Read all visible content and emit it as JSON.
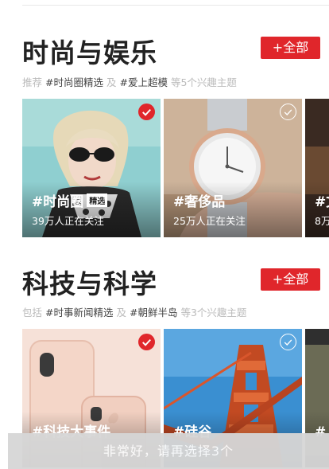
{
  "sections": [
    {
      "title": "时尚与娱乐",
      "all_button": "+全部",
      "sub_prefix": "推荐",
      "sub_topic1": "#时尚圈精选",
      "sub_and": "及",
      "sub_topic2": "#爱上超模",
      "sub_suffix": "等5个兴趣主题",
      "cards": [
        {
          "tag": "#时尚圈",
          "badge": "精选",
          "follow": "39万人正在关注",
          "checked": true
        },
        {
          "tag": "#奢侈品",
          "follow": "25万人正在关注",
          "checked": false
        },
        {
          "tag": "#文",
          "follow": "8万"
        }
      ]
    },
    {
      "title": "科技与科学",
      "all_button": "+全部",
      "sub_prefix": "包括",
      "sub_topic1": "#时事新闻精选",
      "sub_and": "及",
      "sub_topic2": "#朝鲜半岛",
      "sub_suffix": "等3个兴趣主题",
      "cards": [
        {
          "tag": "#科技大事件",
          "checked": true
        },
        {
          "tag": "#硅谷",
          "checked": false
        },
        {
          "tag": "#"
        }
      ]
    }
  ],
  "bottom_bar": {
    "label": "非常好，请再选择3个"
  }
}
